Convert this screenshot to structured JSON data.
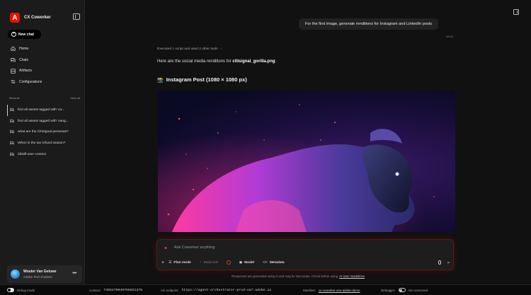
{
  "app": {
    "name": "CX Coworker",
    "logo_letter": "A",
    "brand_color": "#eb1000"
  },
  "sidebar": {
    "new_chat_label": "New chat",
    "nav": [
      {
        "label": "Home",
        "icon": "home-icon"
      },
      {
        "label": "Chats",
        "icon": "chats-icon"
      },
      {
        "label": "Artifacts",
        "icon": "artifacts-icon"
      },
      {
        "label": "Configurations",
        "icon": "sliders-icon"
      }
    ],
    "recents_label": "Recents",
    "view_all_label": "View all",
    "recents": [
      "find all assets tagged with 'va...",
      "find all assets tagged with 'vang...",
      "what are the CitiSignal personas?",
      "When is the tax refund season?",
      "/distill-user-context"
    ],
    "user": {
      "name": "Wouter Van Geluwe",
      "org": "Adobe Tech Insiders"
    }
  },
  "chat": {
    "user_message": "For the first image, generate renditions for Instagram and LinkedIn posts",
    "user_message_time": "12:24",
    "executed_label": "Executed 1 script and used 2 other tools",
    "intro_prefix": "Here are the social media renditions for ",
    "intro_file": "citisignal_gorilla.png",
    "intro_suffix": ":",
    "section_title": "Instagram Post (1080 × 1080 px)"
  },
  "composer": {
    "placeholder": "Ask Coworker anything",
    "plan_mode_label": "Plan mode",
    "balanced_label": "Balanced",
    "model_label": "Model",
    "metadata_label": "Metadata"
  },
  "disclaimer": {
    "text": "Responses are generated using AI and may be inaccurate. Check before using.",
    "link": "AI User Guidelines"
  },
  "footer": {
    "debug_mode_label": "Debug mode",
    "contact_label": "Contact:",
    "contact_value": "7485170949755621376",
    "endpoint_label": "AO endpoint:",
    "endpoint_value": "https://agent-orchestrator-prod-va7.adobe.io",
    "manifest_label": "Manifest:",
    "manifest_value": "cx-coworker-one-adobe-demo",
    "debugger_label": "Debugger:",
    "debugger_status": "not connected"
  }
}
